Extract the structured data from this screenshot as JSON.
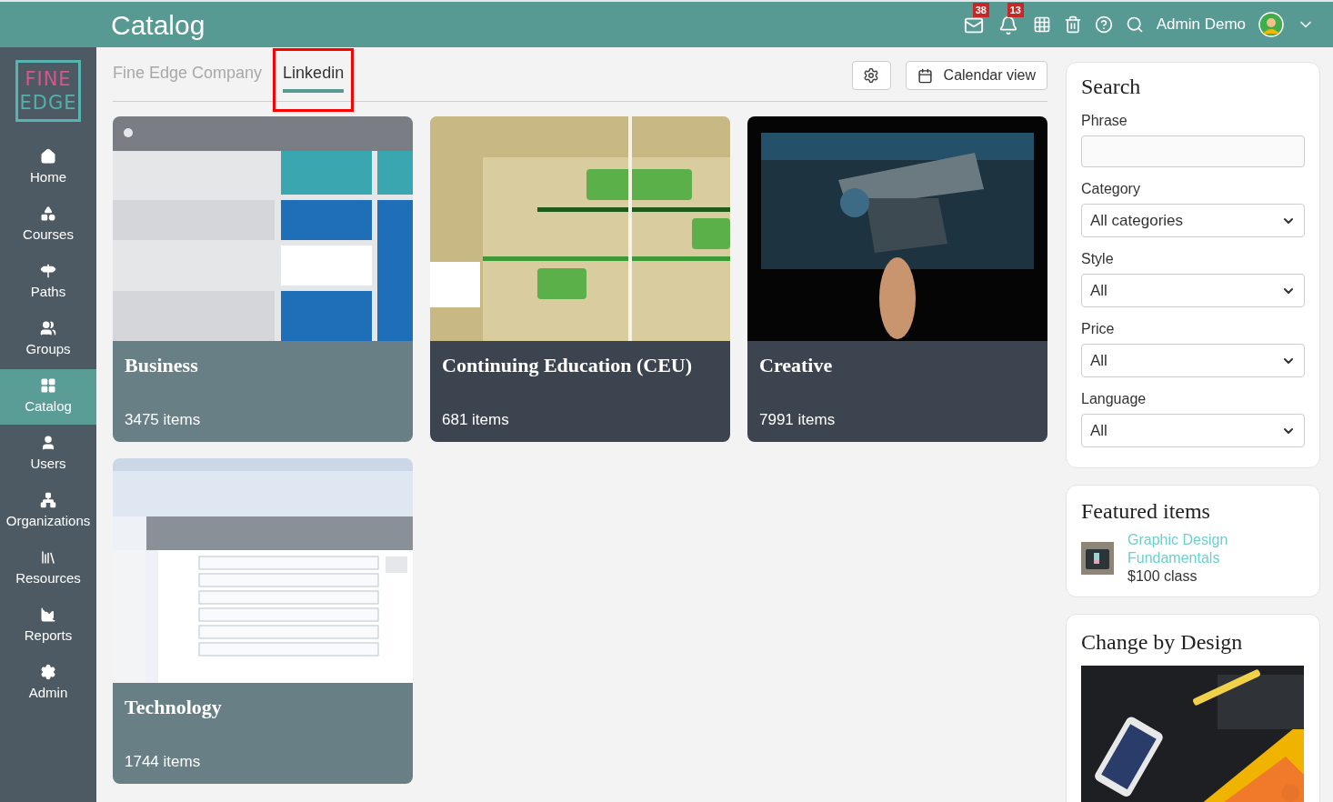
{
  "topbar": {
    "title": "Catalog",
    "notifications": [
      {
        "kind": "mail",
        "badge": "38"
      },
      {
        "kind": "bell",
        "badge": "13"
      }
    ],
    "user": "Admin Demo"
  },
  "logo": {
    "lines": [
      "FINE",
      "EDGE"
    ]
  },
  "sidebar": {
    "items": [
      {
        "label": "Home",
        "selected": false
      },
      {
        "label": "Courses",
        "selected": false
      },
      {
        "label": "Paths",
        "selected": false
      },
      {
        "label": "Groups",
        "selected": false
      },
      {
        "label": "Catalog",
        "selected": true
      },
      {
        "label": "Users",
        "selected": false
      },
      {
        "label": "Organizations",
        "selected": false
      },
      {
        "label": "Resources",
        "selected": false
      },
      {
        "label": "Reports",
        "selected": false
      },
      {
        "label": "Admin",
        "selected": false
      }
    ]
  },
  "tabs": [
    {
      "label": "Fine Edge Company",
      "selected": false,
      "highlighted": false
    },
    {
      "label": "Linkedin",
      "selected": true,
      "highlighted": true
    }
  ],
  "toolbar": {
    "calendar_button": "Calendar view"
  },
  "cards": [
    {
      "title": "Business",
      "count": "3475 items",
      "color": "#687f86"
    },
    {
      "title": "Continuing Education (CEU)",
      "count": "681 items",
      "color": "#3c4450"
    },
    {
      "title": "Creative",
      "count": "7991 items",
      "color": "#3c4450"
    },
    {
      "title": "Technology",
      "count": "1744 items",
      "color": "#687f86"
    }
  ],
  "search": {
    "title": "Search",
    "phrase_label": "Phrase",
    "filters": [
      {
        "label": "Category",
        "value": "All categories"
      },
      {
        "label": "Style",
        "value": "All"
      },
      {
        "label": "Price",
        "value": "All"
      },
      {
        "label": "Language",
        "value": "All"
      }
    ]
  },
  "featured": {
    "title": "Featured items",
    "items": [
      {
        "title": "Graphic Design Fundamentals",
        "price": "$100 class"
      }
    ]
  },
  "promo": {
    "title": "Change by Design"
  }
}
